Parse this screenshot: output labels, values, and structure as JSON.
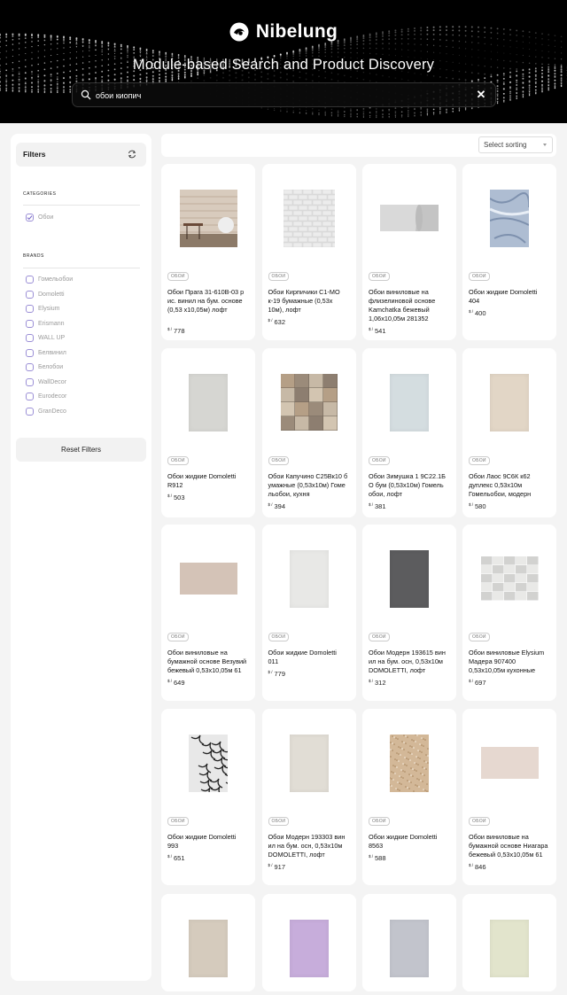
{
  "brand": {
    "name": "Nibelung"
  },
  "hero": {
    "title": "Module-based Search and Product Discovery"
  },
  "search": {
    "value": "обои киопич"
  },
  "sidebar": {
    "filters_label": "Filters",
    "categories_label": "CATEGORIES",
    "categories": [
      {
        "label": "Обои",
        "checked": true
      }
    ],
    "brands_label": "BRANDS",
    "brands": [
      {
        "label": "Гомельобои",
        "checked": false
      },
      {
        "label": "Domoletti",
        "checked": false
      },
      {
        "label": "Elysium",
        "checked": false
      },
      {
        "label": "Erismann",
        "checked": false
      },
      {
        "label": "WALL UP",
        "checked": false
      },
      {
        "label": "Белвинил",
        "checked": false
      },
      {
        "label": "Белобои",
        "checked": false
      },
      {
        "label": "WallDecor",
        "checked": false
      },
      {
        "label": "Eurodecor",
        "checked": false
      },
      {
        "label": "GranDeco",
        "checked": false
      }
    ],
    "reset_label": "Reset Filters"
  },
  "sort": {
    "value": "Select sorting"
  },
  "currency": "$ /",
  "products": [
    {
      "tag": "ОБОИ",
      "name": "Обои Прага 31-610В-03 р ис. винил на бум. основе (0,53 х10,05м) лофт",
      "price": "778",
      "swatch": "#c9b8a6",
      "style": "room"
    },
    {
      "tag": "ОБОИ",
      "name": "Обои Кирпичики С1-МО к-19 бумажные (0,53x 10м), лофт",
      "price": "632",
      "swatch": "#e4e4e4",
      "style": "brick"
    },
    {
      "tag": "ОБОИ",
      "name": "Обои виниловые на флизелиновой основе Kamchatka бежевый 1,06x10,05м 281352",
      "price": "541",
      "swatch": "#d9d9d9",
      "style": "roll"
    },
    {
      "tag": "ОБОИ",
      "name": "Обои жидкие Domoletti 404",
      "price": "400",
      "swatch": "#aebdd2",
      "style": "marble"
    },
    {
      "tag": "ОБОИ",
      "name": "Обои жидкие Domoletti R912",
      "price": "503",
      "swatch": "#d6d6d2",
      "style": "panel"
    },
    {
      "tag": "ОБОИ",
      "name": "Обои Капучино С25Вк10 б умажные (0,53х10м) Гоме льобои, кухня",
      "price": "394",
      "swatch": "#a89c8c",
      "style": "tiles"
    },
    {
      "tag": "ОБОИ",
      "name": "Обои Зимушка 1 9С22.1Б О бум (0,53х10м) Гомель обои, лофт",
      "price": "381",
      "swatch": "#d4dde0",
      "style": "panel"
    },
    {
      "tag": "ОБОИ",
      "name": "Обои Лаос 9С6К к62 дуплекс 0,53х10м Гомельобои, модерн",
      "price": "580",
      "swatch": "#e2d6c6",
      "style": "panel"
    },
    {
      "tag": "ОБОИ",
      "name": "Обои виниловые на бумажной основе Везувий бежевый 0,53х10,05м 61",
      "price": "649",
      "swatch": "#d4c3b7",
      "style": "wide"
    },
    {
      "tag": "ОБОИ",
      "name": "Обои жидкие Domoletti 011",
      "price": "779",
      "swatch": "#e8e8e6",
      "style": "panel"
    },
    {
      "tag": "ОБОИ",
      "name": "Обои Модерн 193615 вин ил на бум. осн, 0,53х10м DOMOLETTI, лофт",
      "price": "312",
      "swatch": "#5c5c5e",
      "style": "panel"
    },
    {
      "tag": "ОБОИ",
      "name": "Обои виниловые Elysium Мадера 907400 0,53х10,05м кухонные",
      "price": "697",
      "swatch": "#dcdcda",
      "style": "blocks"
    },
    {
      "tag": "ОБОИ",
      "name": "Обои жидкие Domoletti 993",
      "price": "651",
      "swatch": "#b6b6b6",
      "style": "floral"
    },
    {
      "tag": "ОБОИ",
      "name": "Обои Модерн 193303 вин ил на бум. осн, 0,53х10м DOMOLETTI, лофт",
      "price": "917",
      "swatch": "#e1ddd5",
      "style": "panel"
    },
    {
      "tag": "ОБОИ",
      "name": "Обои жидкие Domoletti 8563",
      "price": "588",
      "swatch": "#d3b898",
      "style": "speckle"
    },
    {
      "tag": "ОБОИ",
      "name": "Обои виниловые на бумажной основе Ниагара бежевый 0,53x10,05м 61",
      "price": "846",
      "swatch": "#e6d8d0",
      "style": "wide"
    },
    {
      "tag": "",
      "name": "",
      "price": "",
      "swatch": "#d5cbbd",
      "style": "panel"
    },
    {
      "tag": "",
      "name": "",
      "price": "",
      "swatch": "#c7addb",
      "style": "panel"
    },
    {
      "tag": "",
      "name": "",
      "price": "",
      "swatch": "#c2c4cc",
      "style": "panel"
    },
    {
      "tag": "",
      "name": "",
      "price": "",
      "swatch": "#e2e4cc",
      "style": "panel"
    }
  ]
}
